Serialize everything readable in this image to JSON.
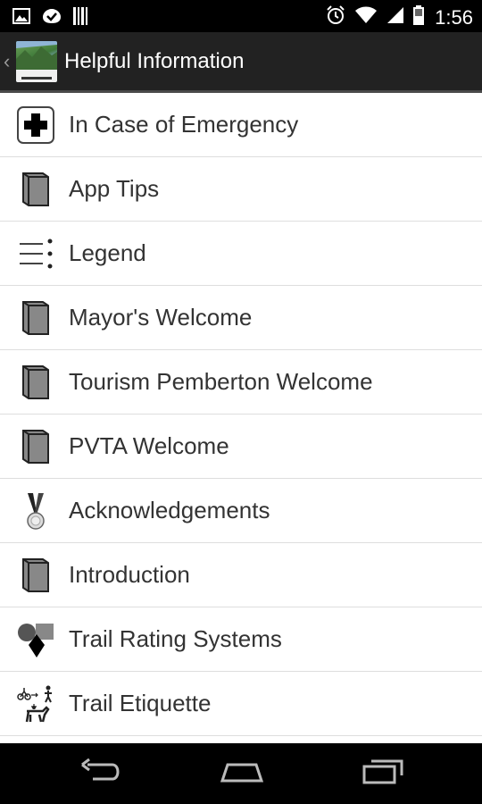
{
  "status_bar": {
    "time": "1:56"
  },
  "action_bar": {
    "title": "Helpful Information",
    "up_caret": "‹"
  },
  "list": {
    "items": [
      {
        "label": "In Case of Emergency",
        "icon": "first-aid-icon"
      },
      {
        "label": "App Tips",
        "icon": "book-icon"
      },
      {
        "label": "Legend",
        "icon": "legend-icon"
      },
      {
        "label": "Mayor's Welcome",
        "icon": "book-icon"
      },
      {
        "label": "Tourism Pemberton Welcome",
        "icon": "book-icon"
      },
      {
        "label": "PVTA Welcome",
        "icon": "book-icon"
      },
      {
        "label": "Acknowledgements",
        "icon": "medal-icon"
      },
      {
        "label": "Introduction",
        "icon": "book-icon"
      },
      {
        "label": "Trail Rating Systems",
        "icon": "trail-rating-icon"
      },
      {
        "label": "Trail Etiquette",
        "icon": "trail-etiquette-icon"
      }
    ]
  },
  "colors": {
    "action_bar_bg": "#222222",
    "list_bg": "#ffffff",
    "text": "#333333",
    "divider": "#dedede"
  }
}
